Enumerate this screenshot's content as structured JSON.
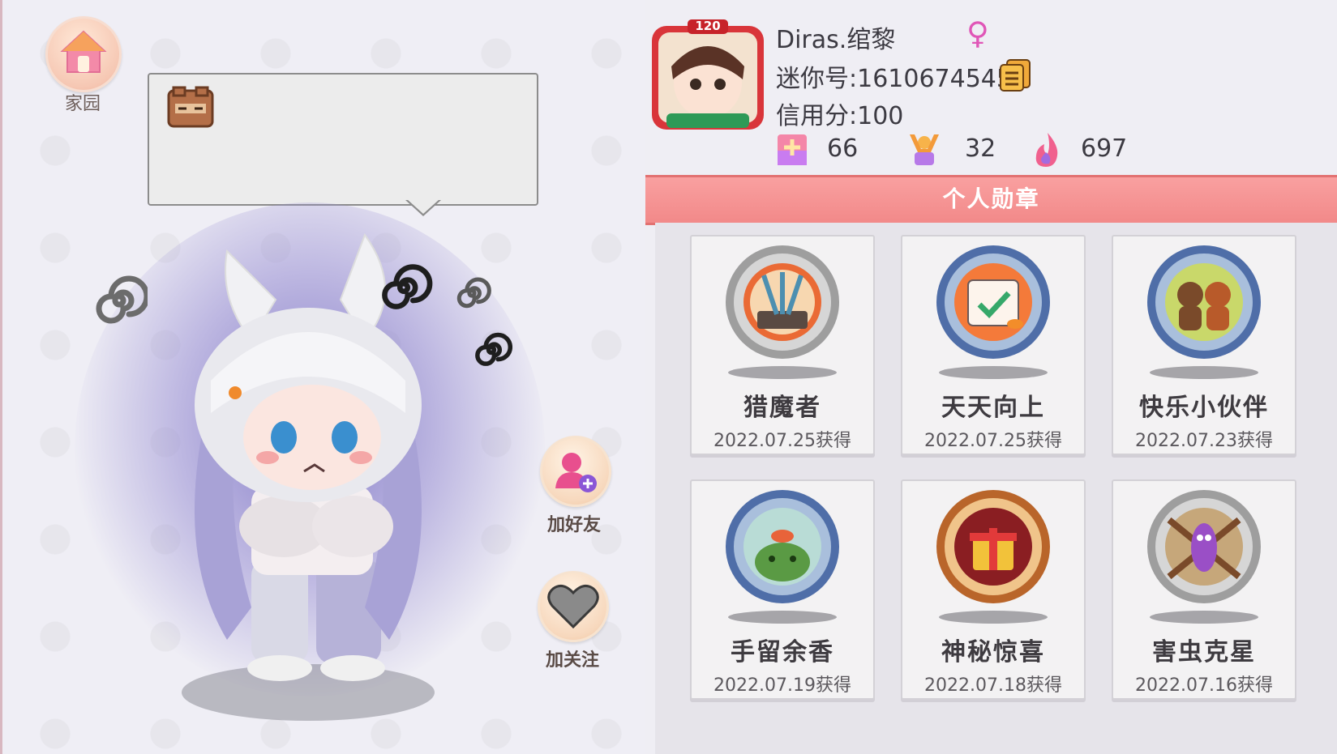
{
  "home": {
    "label": "家园",
    "icon": "house-icon"
  },
  "profile": {
    "name": "Diras.绾黎",
    "gender_symbol": "♀",
    "level_badge": "120",
    "mini_id": "迷你号:1610674545",
    "credit": "信用分:100",
    "stats": [
      {
        "icon": "plus-card-icon",
        "value": "66"
      },
      {
        "icon": "cheer-person-icon",
        "value": "32"
      },
      {
        "icon": "flame-icon",
        "value": "697"
      }
    ]
  },
  "actions": {
    "add_friend": "加好友",
    "follow": "加关注"
  },
  "medals": {
    "title": "个人勋章",
    "items": [
      {
        "name": "猎魔者",
        "date": "2022.07.25获得",
        "icon": "swords-medal-icon"
      },
      {
        "name": "天天向上",
        "date": "2022.07.25获得",
        "icon": "calendar-medal-icon"
      },
      {
        "name": "快乐小伙伴",
        "date": "2022.07.23获得",
        "icon": "friends-medal-icon"
      },
      {
        "name": "手留余香",
        "date": "2022.07.19获得",
        "icon": "frog-medal-icon"
      },
      {
        "name": "神秘惊喜",
        "date": "2022.07.18获得",
        "icon": "gift-medal-icon"
      },
      {
        "name": "害虫克星",
        "date": "2022.07.16获得",
        "icon": "bug-medal-icon"
      }
    ]
  },
  "colors": {
    "accent": "#f28989",
    "gender": "#e056b7",
    "text": "#3c3a42"
  }
}
